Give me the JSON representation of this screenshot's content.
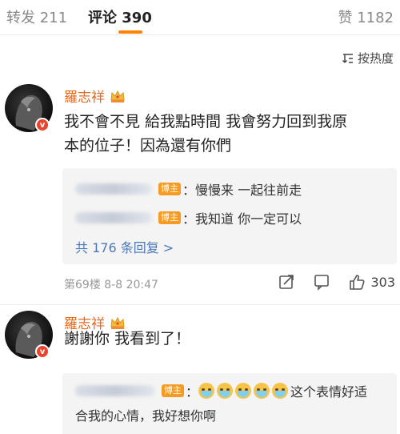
{
  "tabs": {
    "repost": "转发 211",
    "comments": "评论 390",
    "likes": "赞 1182"
  },
  "sort": {
    "label": "按热度",
    "icon": "sort-icon"
  },
  "colors": {
    "accent": "#ff8200",
    "username": "#e86a1f",
    "link": "#4a79b8",
    "badge": "#f59b23"
  },
  "comments": [
    {
      "username": "羅志祥",
      "text_line1": "我不會不見 給我點時間 我會努力回到我原",
      "text_line2": "本的位子！因為還有你們",
      "replies": [
        {
          "badge": "博主",
          "text": "：慢慢来 一起往前走"
        },
        {
          "badge": "博主",
          "text": "：我知道 你一定可以"
        }
      ],
      "more_replies": "共 176 条回复 >",
      "meta": "第69楼 8-8 20:47",
      "likes": "303"
    },
    {
      "username": "羅志祥",
      "text_line1": "謝謝你 我看到了！",
      "replies": [
        {
          "badge": "博主",
          "text_line1": "这个表情好适",
          "text_line2": "合我的心情，我好想你啊",
          "emoji_count": 5
        }
      ]
    }
  ]
}
